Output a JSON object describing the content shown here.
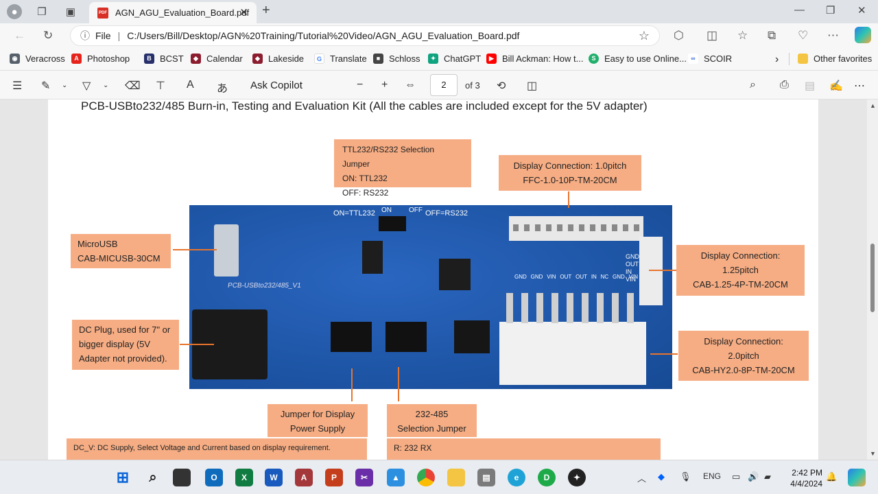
{
  "browser": {
    "tab_title": "AGN_AGU_Evaluation_Board.pdf",
    "url_scheme": "File",
    "url": "C:/Users/Bill/Desktop/AGN%20Training/Tutorial%20Video/AGN_AGU_Evaluation_Board.pdf"
  },
  "favorites": [
    "Veracross",
    "Photoshop",
    "BCST",
    "Calendar",
    "Lakeside",
    "Translate",
    "Schloss",
    "ChatGPT",
    "Bill Ackman: How t...",
    "Easy to use Online...",
    "SCOIR"
  ],
  "other_favorites": "Other favorites",
  "pdf_toolbar": {
    "copilot": "Ask Copilot",
    "page": "2",
    "of": "of 3"
  },
  "document": {
    "heading": "PCB-USBto232/485 Burn-in, Testing and Evaluation Kit (All the cables are included except for the 5V adapter)",
    "notes": {
      "ttl_title": "TTL232/RS232 Selection Jumper",
      "ttl_on": "ON:   TTL232",
      "ttl_off": "OFF:  RS232",
      "disp1_l1": "Display Connection:  1.0pitch",
      "disp1_l2": "FFC-1.0-10P-TM-20CM",
      "micro_l1": "MicroUSB",
      "micro_l2": "CAB-MICUSB-30CM",
      "disp2_l1": "Display Connection:",
      "disp2_l2": "1.25pitch",
      "disp2_l3": "CAB-1.25-4P-TM-20CM",
      "dc_l1": "DC Plug, used for 7\" or",
      "dc_l2": "bigger  display  (5V",
      "dc_l3": "Adapter not provided).",
      "disp3_l1": "Display Connection:",
      "disp3_l2": "2.0pitch",
      "disp3_l3": "CAB-HY2.0-8P-TM-20CM",
      "jumper_l1": "Jumper for Display",
      "jumper_l2": "Power Supply",
      "sel_l1": "232-485",
      "sel_l2": "Selection Jumper",
      "dcv": "DC_V:  DC Supply,  Select Voltage and Current based on display requirement.",
      "r232": "R:  232 RX"
    },
    "board_labels": {
      "on_ttl": "ON=TTL232",
      "on": "ON",
      "off": "OFF",
      "off_rs": "OFF=RS232",
      "silk": "PCB-USBto232/485_V1",
      "pins_right": [
        "GND",
        "OUT",
        "IN",
        "VIN"
      ],
      "pins_bottom": [
        "GND",
        "GND",
        "VIN",
        "OUT",
        "OUT",
        "IN",
        "NC",
        "GND",
        "VIN"
      ]
    }
  },
  "taskbar": {
    "time": "2:42 PM",
    "date": "4/4/2024",
    "lang": "ENG"
  }
}
